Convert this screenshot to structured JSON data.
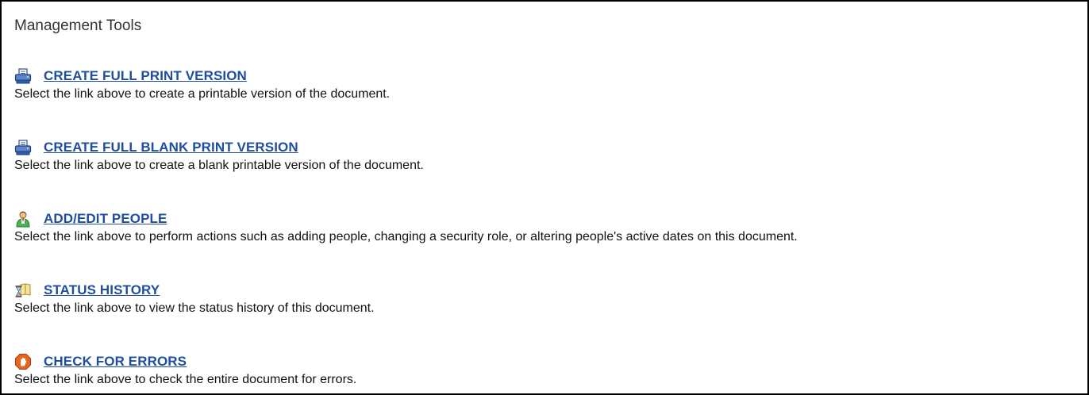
{
  "panel": {
    "title": "Management Tools"
  },
  "tools": [
    {
      "icon": "printer-icon",
      "link": "CREATE FULL PRINT VERSION",
      "description": "Select the link above to create a printable version of the document."
    },
    {
      "icon": "printer-icon",
      "link": "CREATE FULL BLANK PRINT VERSION",
      "description": "Select the link above to create a blank printable version of the document."
    },
    {
      "icon": "person-icon",
      "link": "ADD/EDIT PEOPLE",
      "description": "Select the link above to perform actions such as adding people, changing a security role, or altering people's active dates on this document."
    },
    {
      "icon": "hourglass-book-icon",
      "link": "STATUS HISTORY",
      "description": "Select the link above to view the status history of this document."
    },
    {
      "icon": "stop-hand-icon",
      "link": "CHECK FOR ERRORS",
      "description": "Select the link above to check the entire document for errors."
    }
  ],
  "colors": {
    "link": "#1f4ea0",
    "border": "#000000",
    "text": "#111111"
  }
}
